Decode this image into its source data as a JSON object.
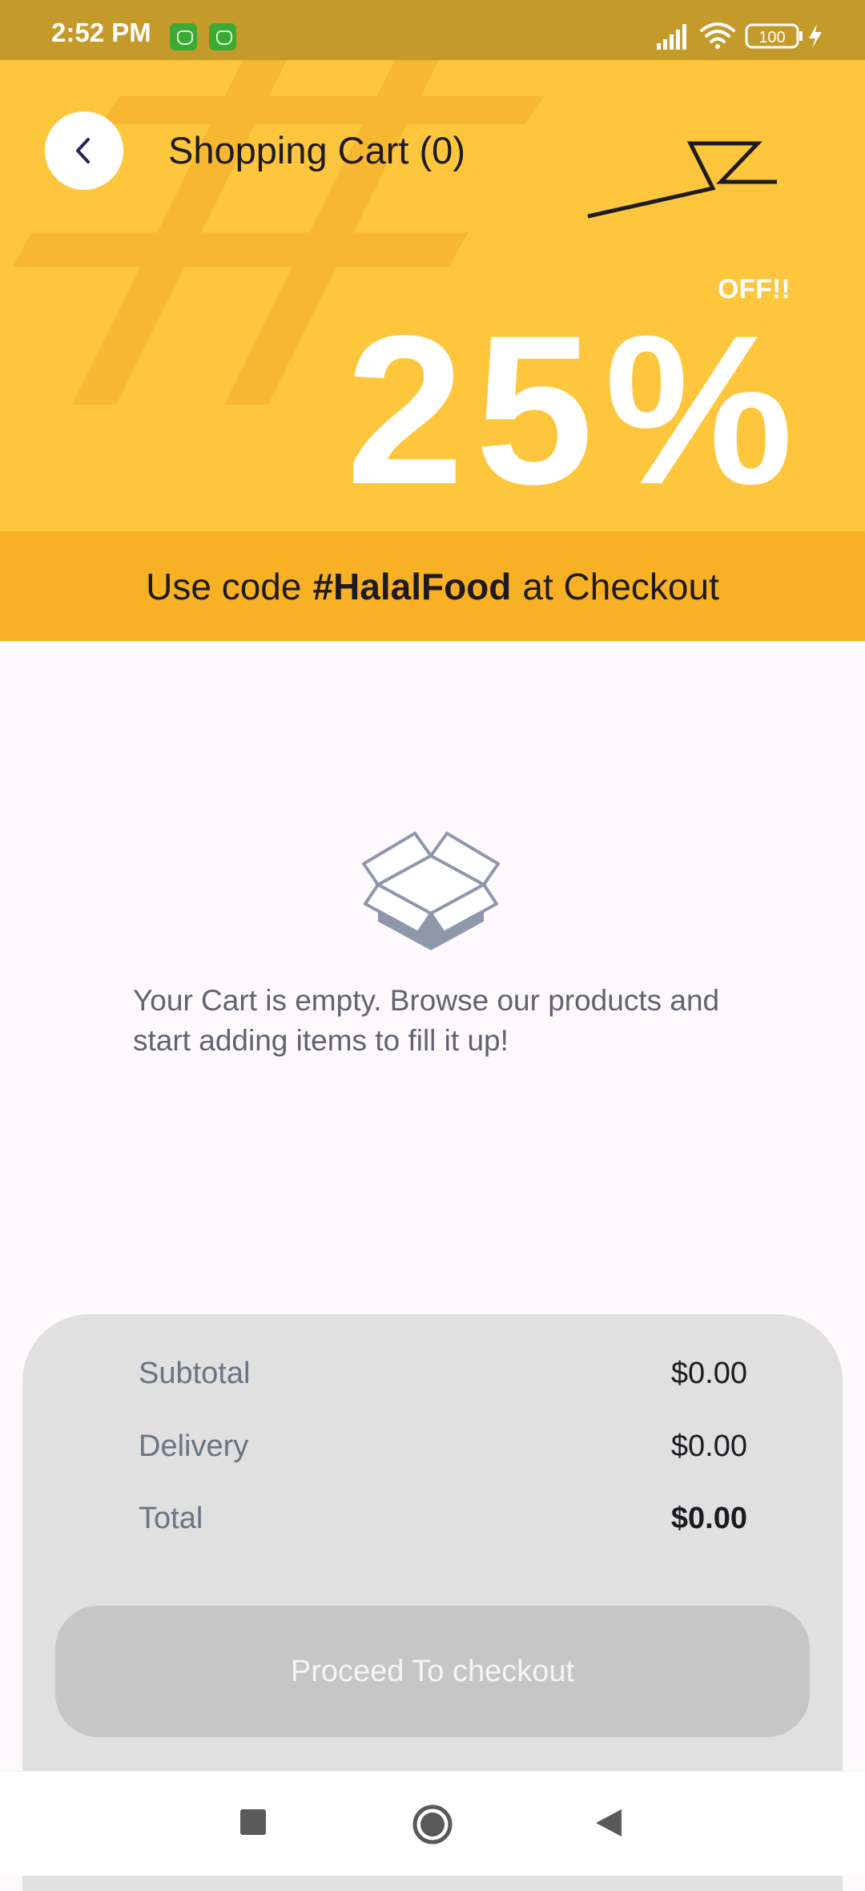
{
  "status_bar": {
    "time": "2:52 PM",
    "battery": "100",
    "notification_icons": [
      "app-notification-icon",
      "app-notification-icon"
    ]
  },
  "header": {
    "title": "Shopping Cart (0)",
    "back_icon": "chevron-left-icon"
  },
  "promo": {
    "off_label": "OFF!!",
    "discount": "25%",
    "code_prefix": "Use code",
    "code": "#HalalFood",
    "code_suffix": "at Checkout"
  },
  "empty_state": {
    "icon": "open-box-icon",
    "message": "Your Cart is empty. Browse our products and start adding items to fill it up!"
  },
  "summary": {
    "subtotal_label": "Subtotal",
    "subtotal_value": "$0.00",
    "delivery_label": "Delivery",
    "delivery_value": "$0.00",
    "total_label": "Total",
    "total_value": "$0.00",
    "checkout_label": "Proceed To checkout"
  },
  "nav": {
    "recents_icon": "square-icon",
    "home_icon": "circle-home-icon",
    "back_icon": "triangle-back-icon"
  },
  "colors": {
    "header_yellow": "#fec63c",
    "promo_orange": "#f8b024",
    "status_bar": "#c49a2b",
    "card_gray": "#e0e0e0",
    "button_gray": "#c6c6c6"
  }
}
